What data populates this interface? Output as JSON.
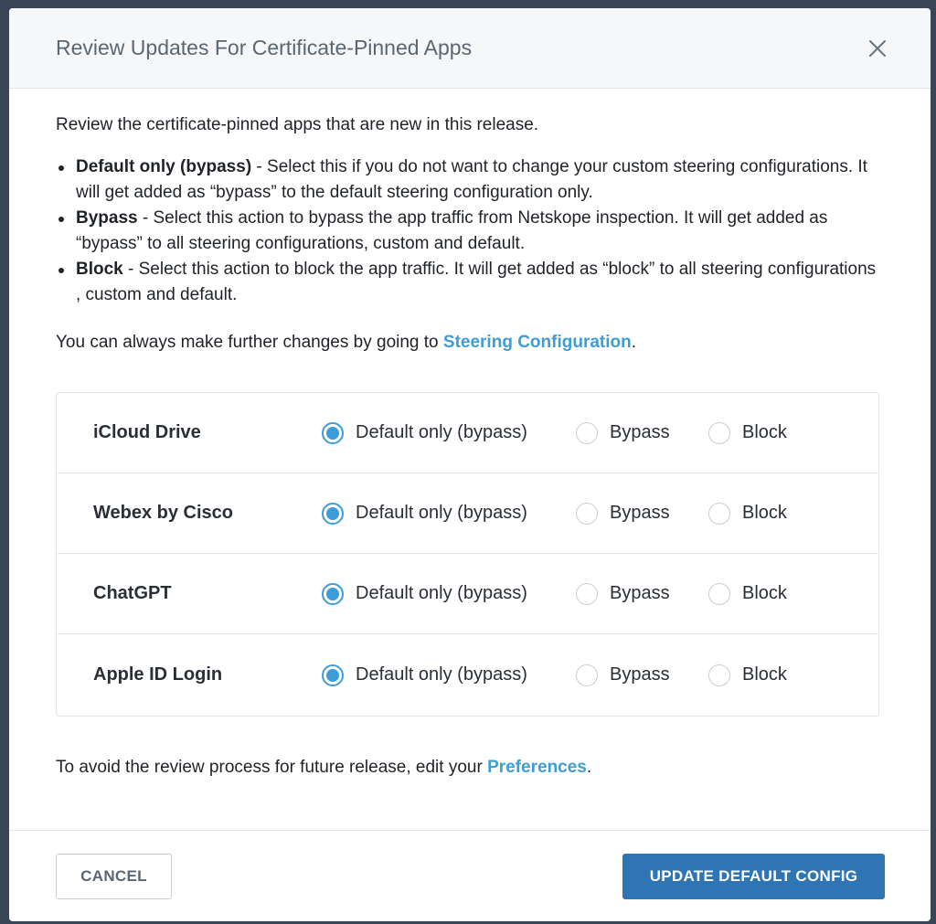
{
  "dialog": {
    "title": "Review Updates For Certificate-Pinned Apps",
    "close_icon": "close-icon"
  },
  "body": {
    "intro": "Review the certificate-pinned apps that are new in this release.",
    "options": [
      {
        "name": "Default only (bypass)",
        "description": " - Select this if you do not want to change your custom steering configurations. It will get added as “bypass” to the default steering configuration only."
      },
      {
        "name": "Bypass",
        "description": " - Select this action to bypass the app traffic from Netskope inspection. It will get added as “bypass” to all steering configurations, custom and default."
      },
      {
        "name": "Block",
        "description": " - Select this action to block the app traffic. It will get added as “block” to all steering configurations , custom and default."
      }
    ],
    "further_prefix": "You can always make further changes by going to ",
    "further_link": "Steering Configuration",
    "further_suffix": ".",
    "footer_prefix": "To avoid the review process for future release, edit your ",
    "footer_link": "Preferences",
    "footer_suffix": "."
  },
  "radio_labels": {
    "default": "Default only (bypass)",
    "bypass": "Bypass",
    "block": "Block"
  },
  "apps": [
    {
      "name": "iCloud Drive",
      "selected": "default"
    },
    {
      "name": "Webex by Cisco",
      "selected": "default"
    },
    {
      "name": "ChatGPT",
      "selected": "default"
    },
    {
      "name": "Apple ID Login",
      "selected": "default"
    }
  ],
  "buttons": {
    "cancel": "CANCEL",
    "update": "UPDATE DEFAULT CONFIG"
  },
  "colors": {
    "accent": "#3d9dd6",
    "primary_button": "#2f75b3"
  }
}
